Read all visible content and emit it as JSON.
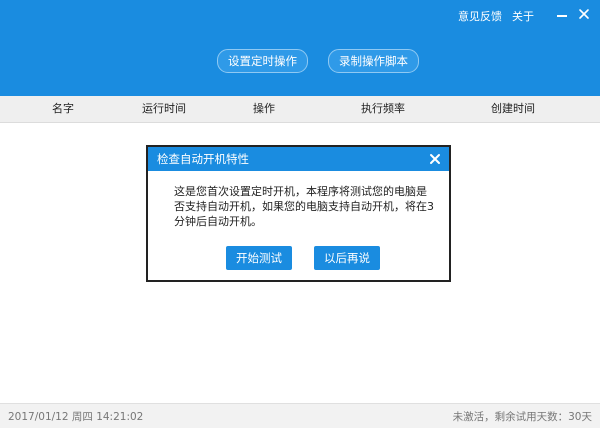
{
  "header": {
    "links": {
      "feedback": "意见反馈",
      "about": "关于"
    },
    "buttons": {
      "set_timer": "设置定时操作",
      "record_script": "录制操作脚本"
    },
    "window_controls": {
      "minimize_icon": "minimize-icon",
      "close_icon": "close-icon"
    }
  },
  "table": {
    "columns": [
      "名字",
      "运行时间",
      "操作",
      "执行频率",
      "创建时间"
    ]
  },
  "dialog": {
    "title": "检查自动开机特性",
    "message": "这是您首次设置定时开机，本程序将测试您的电脑是否支持自动开机，如果您的电脑支持自动开机，将在3分钟后自动开机。",
    "buttons": {
      "start": "开始测试",
      "later": "以后再说"
    }
  },
  "status": {
    "left": "2017/01/12  周四  14:21:02",
    "right": "未激活，剩余试用天数：30天"
  },
  "colors": {
    "accent": "#1a8ce0",
    "header_bg": "#1a8ce0",
    "table_head_bg": "#efefef",
    "status_bg": "#f2f2f2"
  }
}
